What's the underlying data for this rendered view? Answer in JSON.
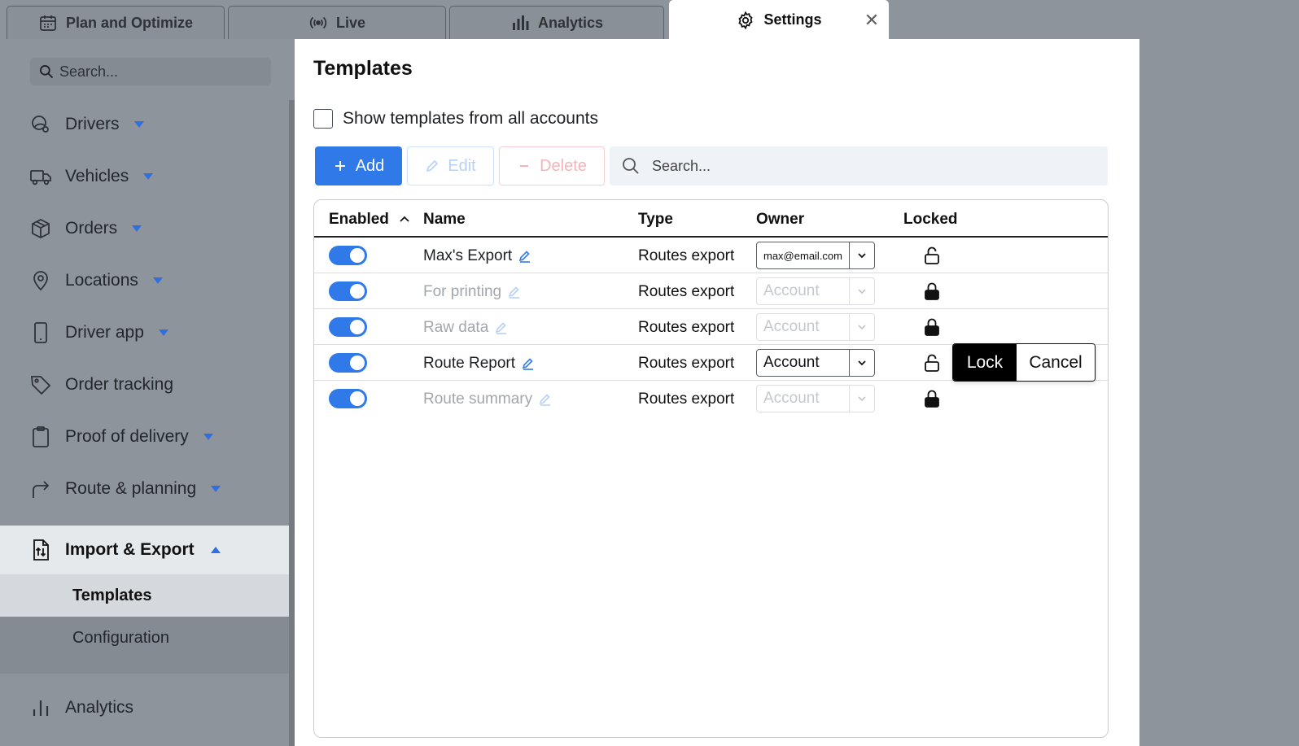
{
  "tabs": [
    {
      "label": "Plan and Optimize",
      "icon": "calendar-icon"
    },
    {
      "label": "Live",
      "icon": "broadcast-icon"
    },
    {
      "label": "Analytics",
      "icon": "bar-chart-icon"
    },
    {
      "label": "Settings",
      "icon": "gear-icon",
      "active": true
    }
  ],
  "sidebar": {
    "search_placeholder": "Search...",
    "items": [
      {
        "label": "Drivers"
      },
      {
        "label": "Vehicles"
      },
      {
        "label": "Orders"
      },
      {
        "label": "Locations"
      },
      {
        "label": "Driver app"
      },
      {
        "label": "Order tracking"
      },
      {
        "label": "Proof of delivery"
      },
      {
        "label": "Route & planning"
      },
      {
        "label": "Import & Export"
      },
      {
        "label": "Analytics"
      }
    ],
    "subitems": [
      {
        "label": "Templates"
      },
      {
        "label": "Configuration"
      }
    ]
  },
  "main": {
    "title": "Templates",
    "show_all_label": "Show templates from all accounts",
    "add_label": "Add",
    "edit_label": "Edit",
    "delete_label": "Delete",
    "search_placeholder": "Search...",
    "columns": {
      "enabled": "Enabled",
      "name": "Name",
      "type": "Type",
      "owner": "Owner",
      "locked": "Locked"
    },
    "rows": [
      {
        "name": "Max's Export",
        "type": "Routes export",
        "owner": "max@email.com"
      },
      {
        "name": "For printing",
        "type": "Routes export",
        "owner": "Account"
      },
      {
        "name": "Raw data",
        "type": "Routes export",
        "owner": "Account"
      },
      {
        "name": "Route Report",
        "type": "Routes export",
        "owner": "Account"
      },
      {
        "name": "Route summary",
        "type": "Routes export",
        "owner": "Account"
      }
    ],
    "lock_popup": {
      "lock_label": "Lock",
      "cancel_label": "Cancel"
    }
  },
  "colors": {
    "accent": "#2f7ae8",
    "sidebar_bg": "#8e949c"
  }
}
